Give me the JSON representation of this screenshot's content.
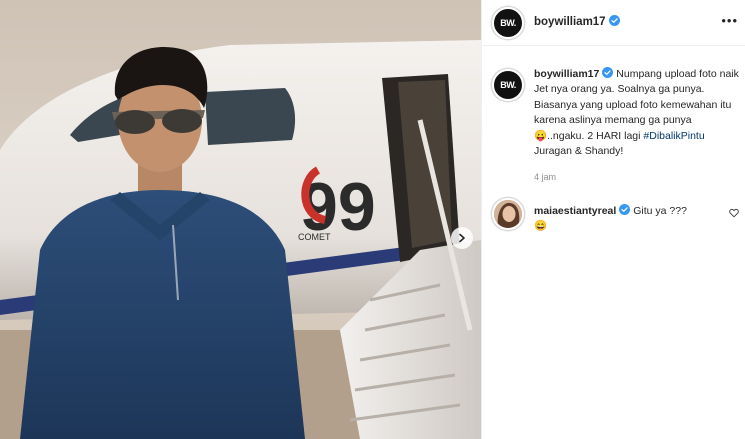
{
  "post": {
    "username": "boywilliam17",
    "avatar_text": "BW.",
    "verified_icon": "verified-badge-icon",
    "more_label": "•••"
  },
  "photo": {
    "jet_logo_large": "99",
    "jet_logo_small": "COMET",
    "next_icon": "chevron-right-icon"
  },
  "caption": {
    "username": "boywilliam17",
    "text_part1": "Numpang upload foto naik Jet nya orang ya. Soalnya ga punya. Biasanya yang upload foto kemewahan itu karena aslinya memang ga punya ",
    "emoji1": "😛",
    "text_part2": "..ngaku. 2 HARI lagi ",
    "hashtag": "#DibalikPintu",
    "text_part3": " Juragan & Shandy!",
    "time": "4 jam"
  },
  "comments": [
    {
      "username": "maiaestiantyreal",
      "text": "Gitu ya ???",
      "emoji": "😄",
      "like_icon": "heart-icon"
    }
  ],
  "colors": {
    "verified": "#3897f0",
    "hashtag": "#00376b",
    "muted": "#8e8e8e"
  }
}
